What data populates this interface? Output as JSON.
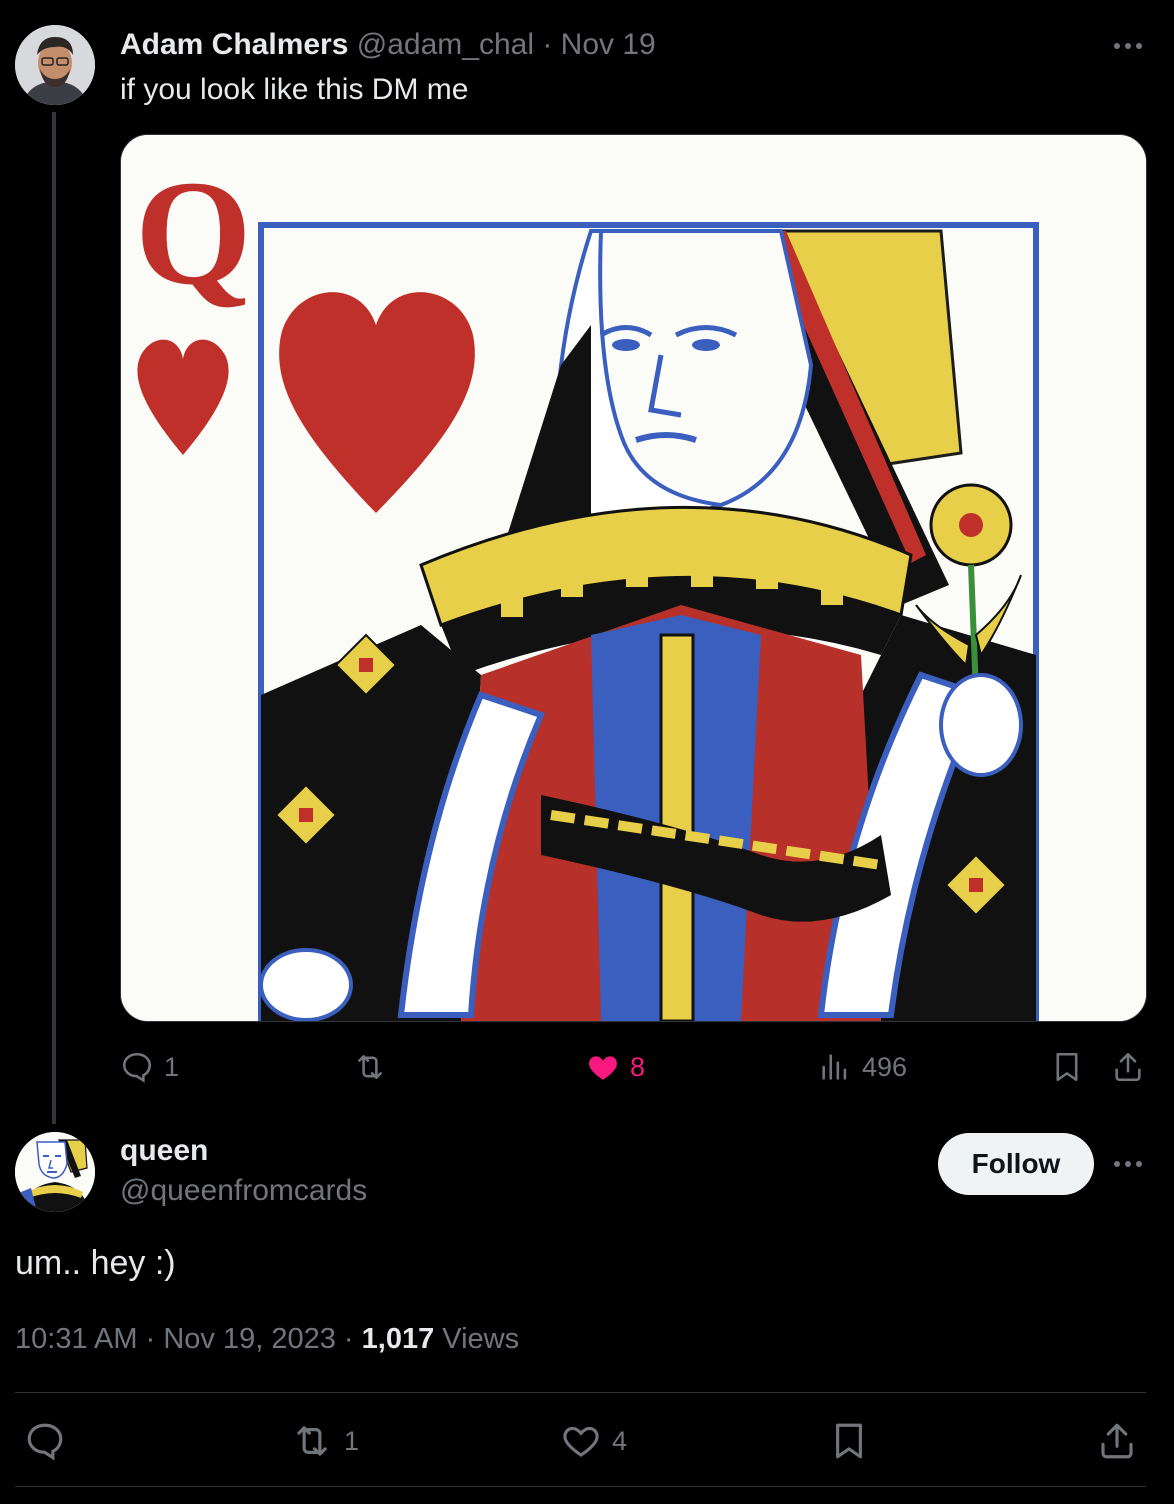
{
  "tweet": {
    "author_name": "Adam Chalmers",
    "handle": "@adam_chal",
    "separator": "·",
    "date": "Nov 19",
    "text": "if you look like this DM me",
    "card_rank": "Q",
    "actions": {
      "replies": "1",
      "likes": "8",
      "views": "496"
    },
    "colors": {
      "like_active": "#f91880"
    }
  },
  "reply": {
    "author_name": "queen",
    "handle": "@queenfromcards",
    "follow_label": "Follow",
    "text": "um.. hey :)",
    "time": "10:31 AM",
    "date": "Nov 19, 2023",
    "views_count": "1,017",
    "views_label": "Views",
    "separator": "·",
    "actions": {
      "retweets": "1",
      "likes": "4"
    }
  }
}
